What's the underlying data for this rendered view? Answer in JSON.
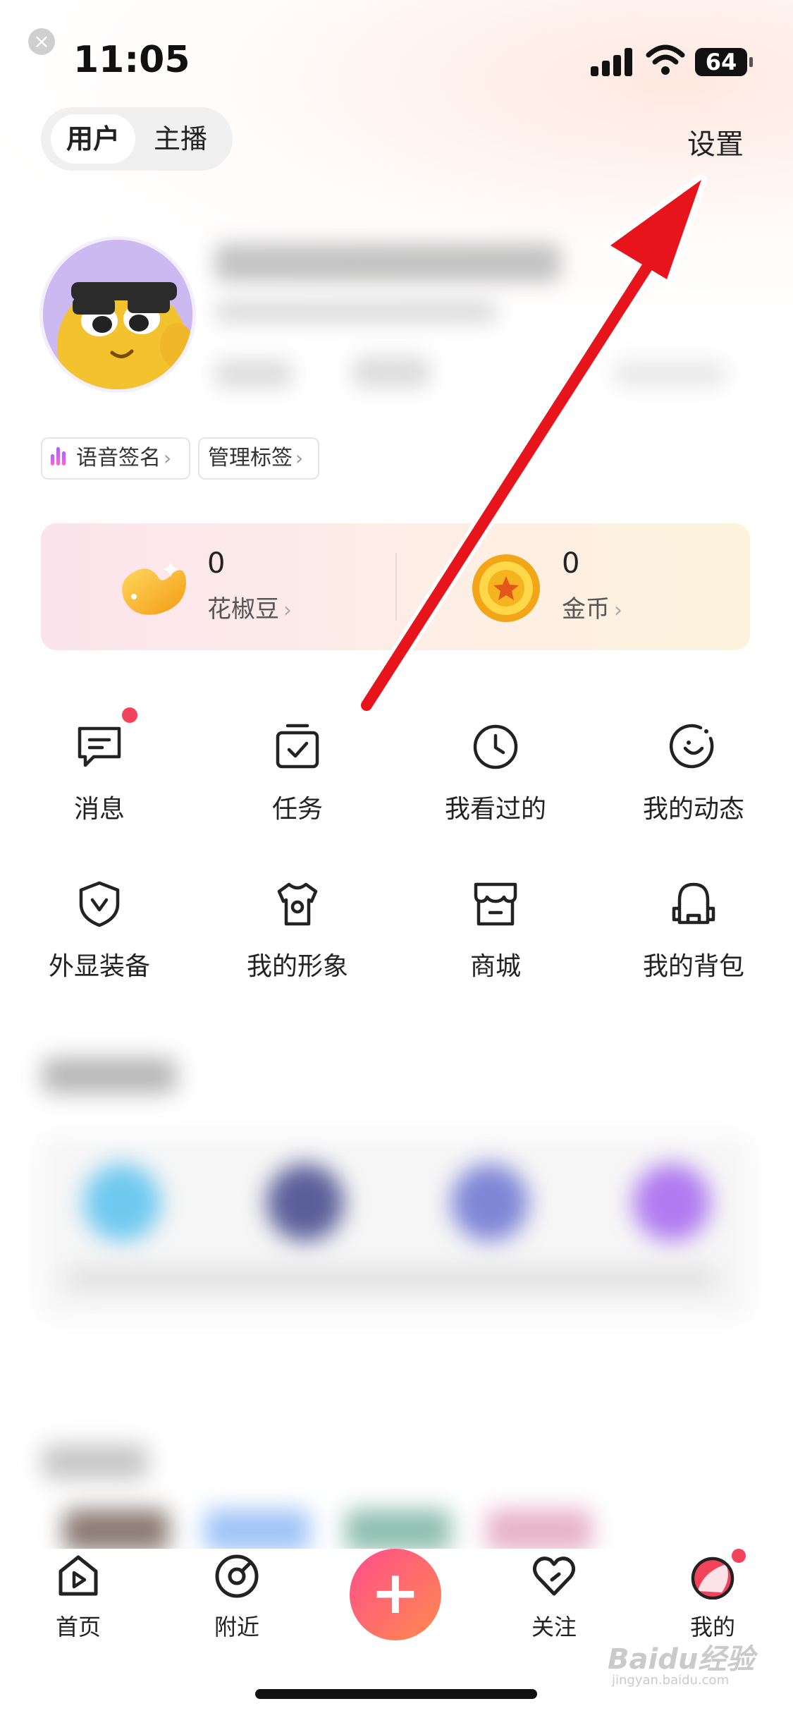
{
  "status_bar": {
    "time": "11:05",
    "battery": "64"
  },
  "header": {
    "role_tabs": [
      "用户",
      "主播"
    ],
    "active_role": "用户",
    "settings_label": "设置"
  },
  "profile": {
    "chips": [
      {
        "label": "语音签名",
        "icon": "voice-wave-icon"
      },
      {
        "label": "管理标签"
      }
    ]
  },
  "wallet": {
    "items": [
      {
        "value": "0",
        "label": "花椒豆",
        "icon": "bean-icon"
      },
      {
        "value": "0",
        "label": "金币",
        "icon": "coin-icon"
      }
    ]
  },
  "grid": {
    "items": [
      {
        "label": "消息",
        "icon": "message-icon",
        "badge": true
      },
      {
        "label": "任务",
        "icon": "task-icon"
      },
      {
        "label": "我看过的",
        "icon": "clock-icon"
      },
      {
        "label": "我的动态",
        "icon": "moments-icon"
      },
      {
        "label": "外显装备",
        "icon": "shield-icon"
      },
      {
        "label": "我的形象",
        "icon": "shirt-icon"
      },
      {
        "label": "商城",
        "icon": "store-icon"
      },
      {
        "label": "我的背包",
        "icon": "backpack-icon"
      }
    ]
  },
  "tabbar": {
    "items": [
      {
        "label": "首页",
        "icon": "home-play-icon"
      },
      {
        "label": "附近",
        "icon": "compass-icon"
      },
      {
        "label": "",
        "icon": "plus-icon"
      },
      {
        "label": "关注",
        "icon": "heart-icon"
      },
      {
        "label": "我的",
        "icon": "profile-face-icon",
        "badge": true
      }
    ]
  },
  "watermark": {
    "text": "Baidu经验",
    "sub": "jingyan.baidu.com"
  },
  "colors": {
    "accent": "#f2425c",
    "arrow": "#e8141c"
  }
}
